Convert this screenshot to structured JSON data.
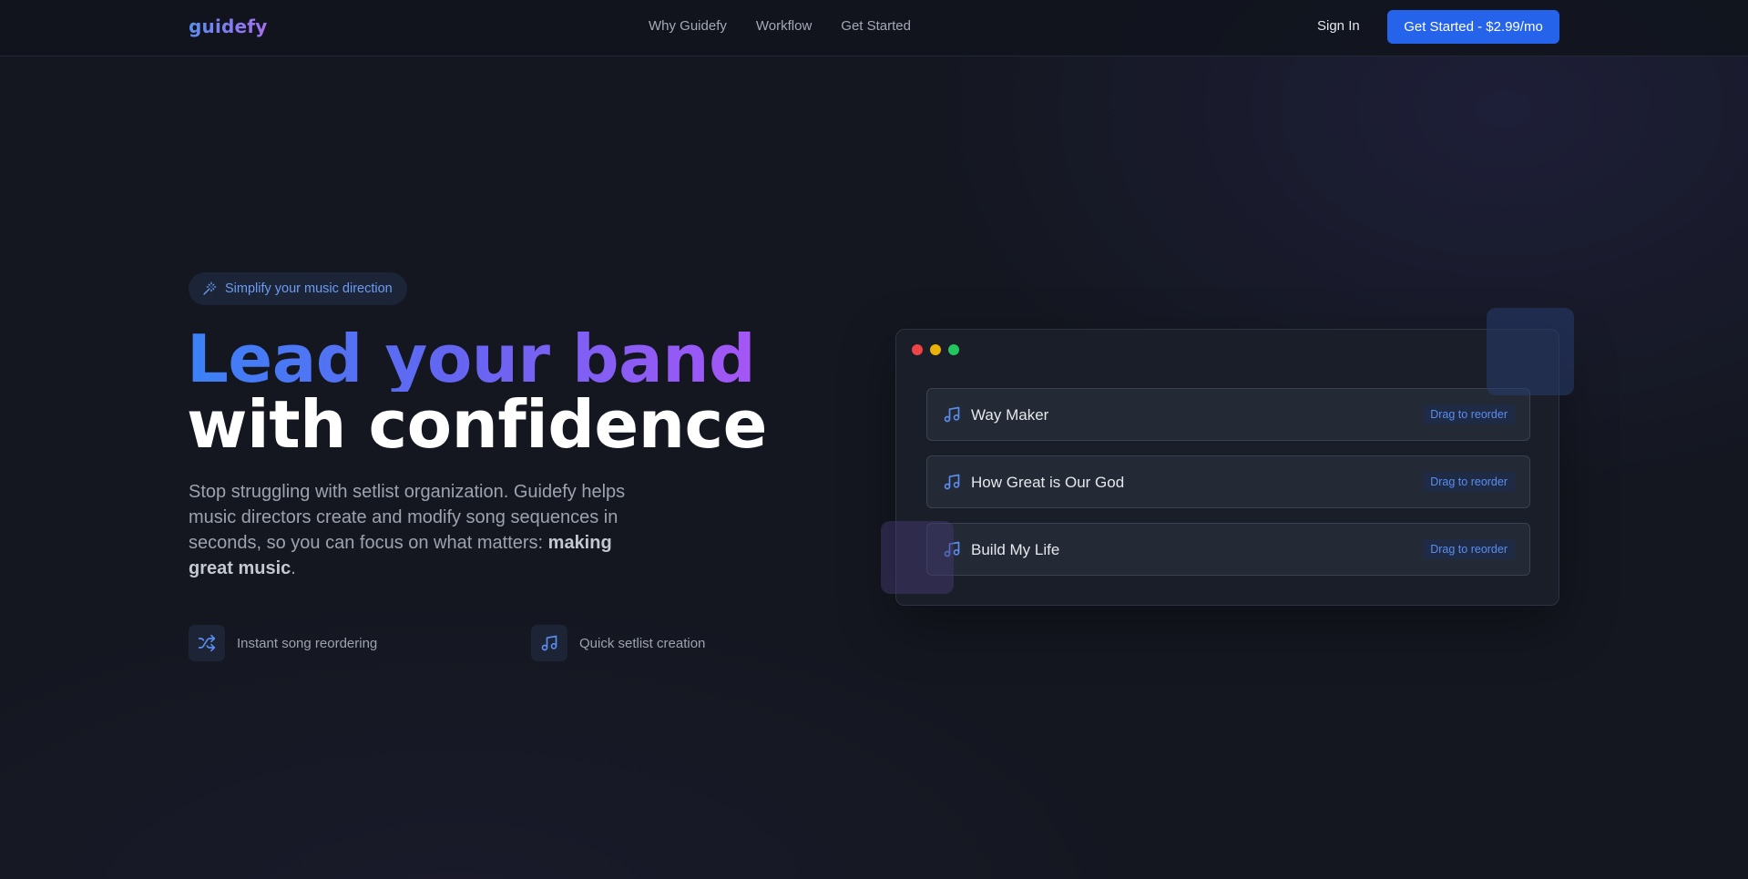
{
  "nav": {
    "logo": "guidefy",
    "links": [
      "Why Guidefy",
      "Workflow",
      "Get Started"
    ],
    "signin": "Sign In",
    "cta": "Get Started - $2.99/mo"
  },
  "hero": {
    "badge": "Simplify your music direction",
    "headline_line1": "Lead your band",
    "headline_line2": "with confidence",
    "subtitle_text": "Stop struggling with setlist organization. Guidefy helps music directors create and modify song sequences in seconds, so you can focus on what matters: ",
    "subtitle_bold": "making great music",
    "subtitle_end": ".",
    "features": [
      {
        "icon": "shuffle-icon",
        "label": "Instant song reordering"
      },
      {
        "icon": "music-note-icon",
        "label": "Quick setlist creation"
      }
    ]
  },
  "mockup": {
    "window_dots": [
      "#ef4444",
      "#eab308",
      "#22c55e"
    ],
    "songs": [
      {
        "title": "Way Maker",
        "action": "Drag to reorder"
      },
      {
        "title": "How Great is Our God",
        "action": "Drag to reorder"
      },
      {
        "title": "Build My Life",
        "action": "Drag to reorder"
      }
    ]
  },
  "colors": {
    "accent": "#2563eb",
    "gradient_start": "#3b82f6",
    "gradient_end": "#a855f7",
    "background": "#141720"
  }
}
